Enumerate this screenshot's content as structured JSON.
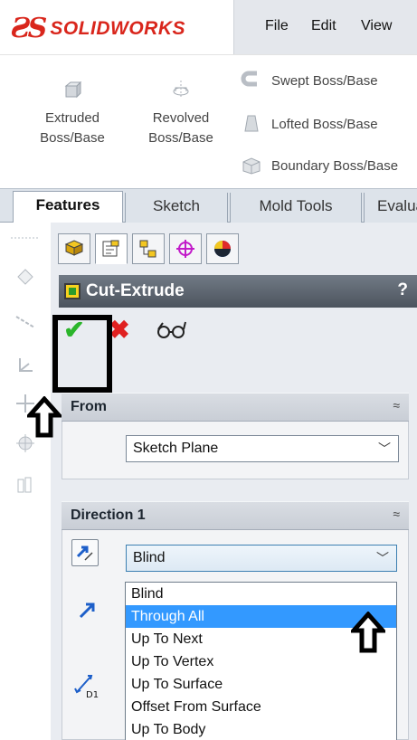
{
  "app": {
    "logo_mark": "ƧS",
    "logo_text": "SOLIDWORKS"
  },
  "menu": [
    {
      "label": "File"
    },
    {
      "label": "Edit"
    },
    {
      "label": "View"
    }
  ],
  "ribbon": {
    "extruded": {
      "line1": "Extruded",
      "line2": "Boss/Base"
    },
    "revolved": {
      "line1": "Revolved",
      "line2": "Boss/Base"
    },
    "swept": "Swept Boss/Base",
    "lofted": "Lofted Boss/Base",
    "boundary": "Boundary Boss/Base"
  },
  "tabs": [
    {
      "label": "Features",
      "active": true
    },
    {
      "label": "Sketch"
    },
    {
      "label": "Mold Tools"
    },
    {
      "label": "Evaluate"
    }
  ],
  "property_manager": {
    "title": "Cut-Extrude",
    "help": "?",
    "ok_icon": "✔",
    "cancel_icon": "✖",
    "icons": [
      "feature-manager-icon",
      "property-manager-icon",
      "configuration-manager-icon",
      "dimxpert-icon",
      "display-manager-icon"
    ],
    "from": {
      "title": "From",
      "collapse": "≈",
      "value": "Sketch Plane"
    },
    "direction1": {
      "title": "Direction 1",
      "collapse": "≈",
      "value": "Blind",
      "depth_label": "D1",
      "options": [
        "Blind",
        "Through All",
        "Up To Next",
        "Up To Vertex",
        "Up To Surface",
        "Offset From Surface",
        "Up To Body"
      ],
      "selected": "Through All"
    }
  },
  "colors": {
    "accent_selection": "#3399ff",
    "brand_red": "#d9261c",
    "ok_green": "#2bb52b",
    "cancel_red": "#e02020"
  }
}
